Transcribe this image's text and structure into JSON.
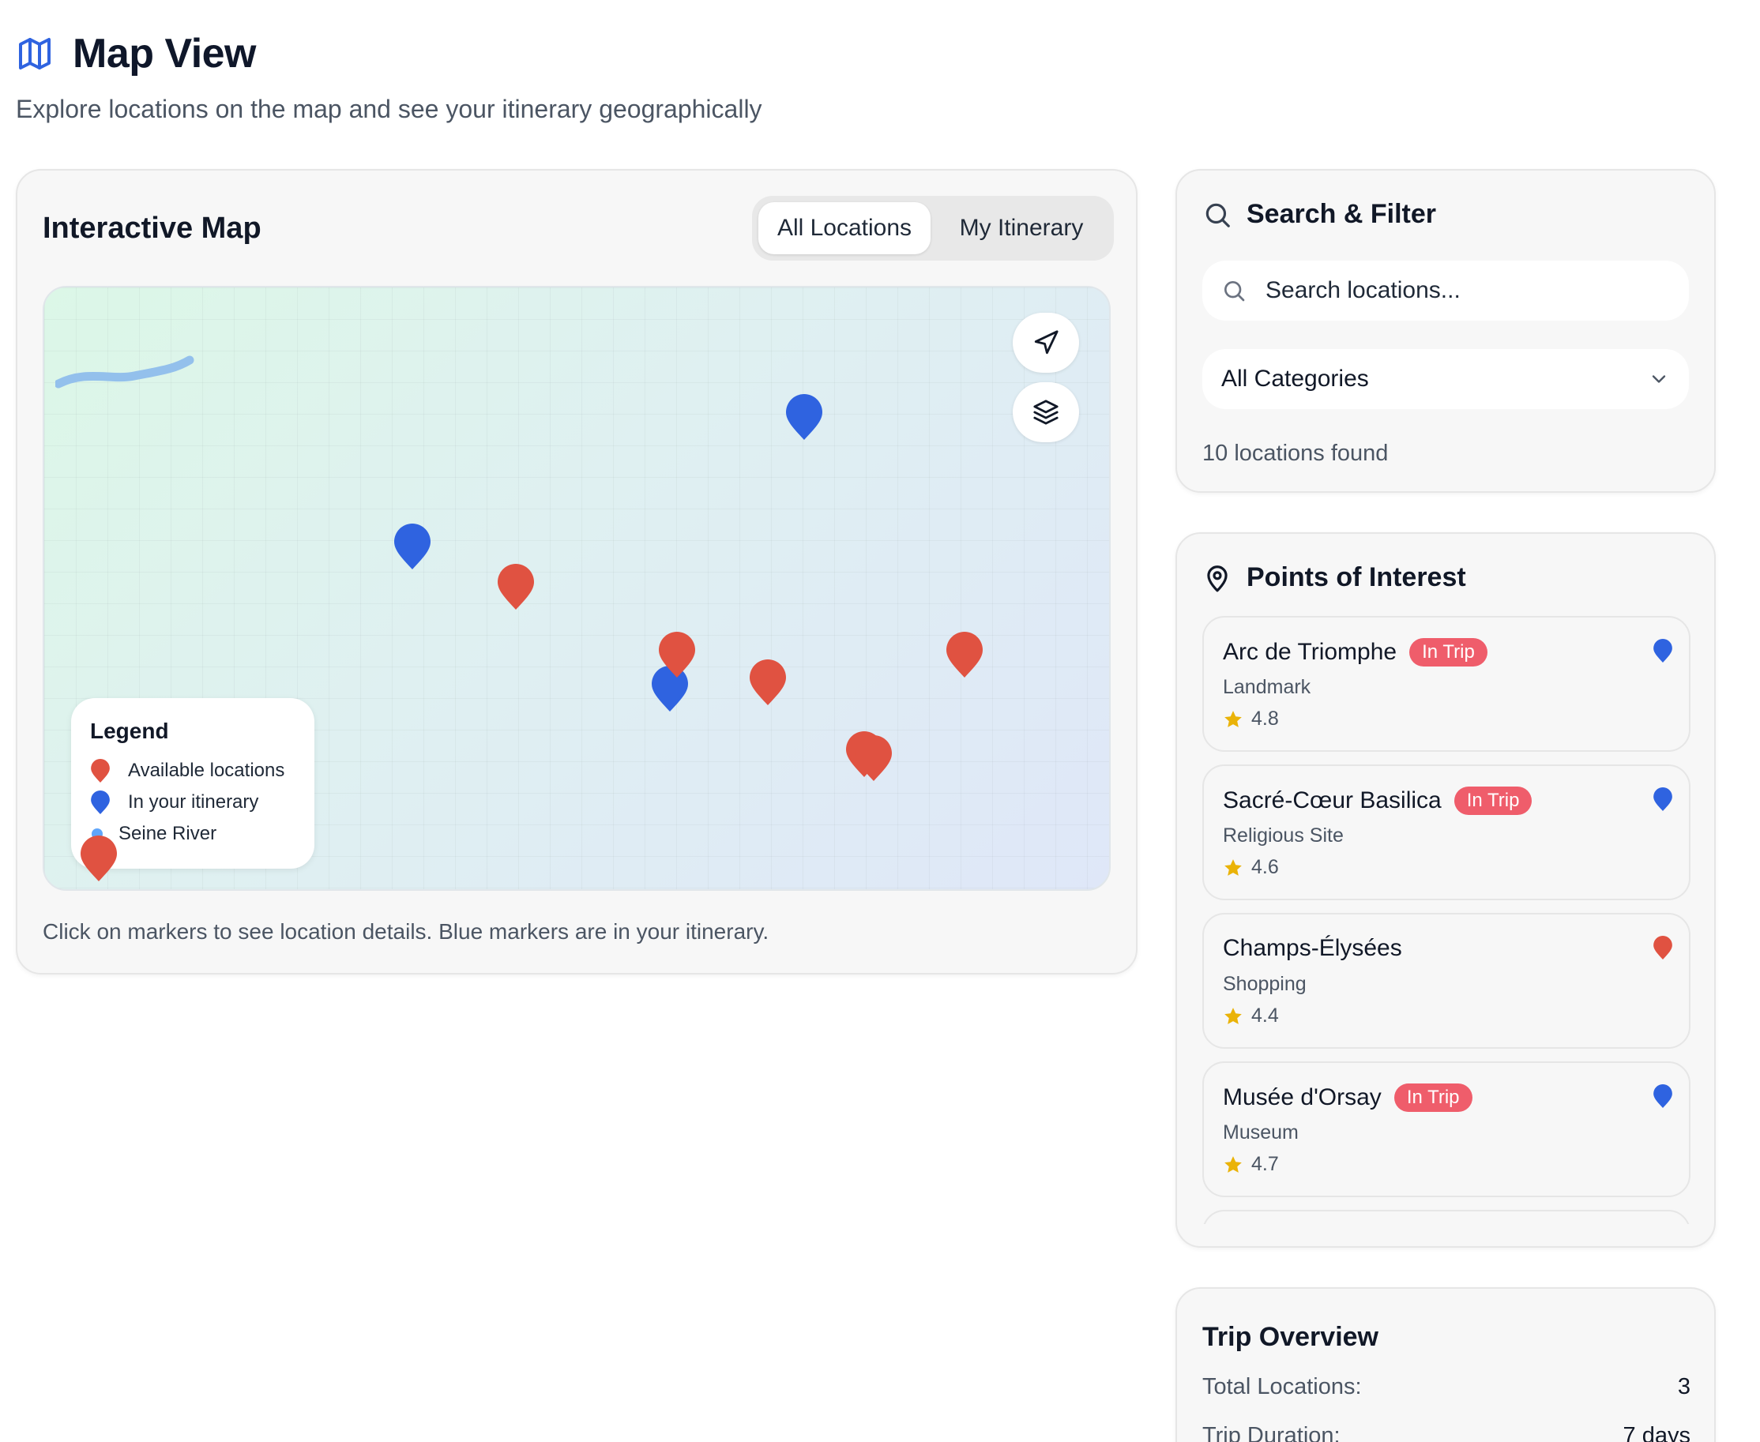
{
  "header": {
    "title": "Map View",
    "subtitle": "Explore locations on the map and see your itinerary geographically"
  },
  "map_card": {
    "title": "Interactive Map",
    "toggle": {
      "all_label": "All Locations",
      "itinerary_label": "My Itinerary",
      "selected": "All Locations"
    },
    "legend": {
      "title": "Legend",
      "available": "Available locations",
      "itinerary": "In your itinerary",
      "river": "Seine River"
    },
    "footnote": "Click on markers to see location details. Blue markers are in your itinerary."
  },
  "search": {
    "title": "Search & Filter",
    "placeholder": "Search locations...",
    "category_selected": "All Categories",
    "result_count": "10 locations found"
  },
  "poi": {
    "title": "Points of Interest",
    "items": [
      {
        "name": "Arc de Triomphe",
        "badge": "In Trip",
        "category": "Landmark",
        "rating": "4.8"
      },
      {
        "name": "Sacré-Cœur Basilica",
        "badge": "In Trip",
        "category": "Religious Site",
        "rating": "4.6"
      },
      {
        "name": "Champs-Élysées",
        "badge": "",
        "category": "Shopping",
        "rating": "4.4"
      },
      {
        "name": "Musée d'Orsay",
        "badge": "In Trip",
        "category": "Museum",
        "rating": "4.7"
      }
    ]
  },
  "trip": {
    "title": "Trip Overview",
    "rows": [
      {
        "label": "Total Locations:",
        "value": "3"
      },
      {
        "label": "Trip Duration:",
        "value": "7 days"
      }
    ]
  },
  "colors": {
    "available_marker": "#e05241",
    "itinerary_marker": "#2f63e0",
    "river": "#93c0ec",
    "badge": "#ef5d6b",
    "accent": "#2f63e0"
  },
  "icons": {
    "title_icon": "map-icon",
    "search_icon": "search-icon",
    "poi_icon": "map-pin-icon",
    "locate_control": "navigation-arrow-icon",
    "layers_control": "layers-icon",
    "select_chevron": "chevron-down-icon",
    "rating_icon": "star-icon"
  }
}
